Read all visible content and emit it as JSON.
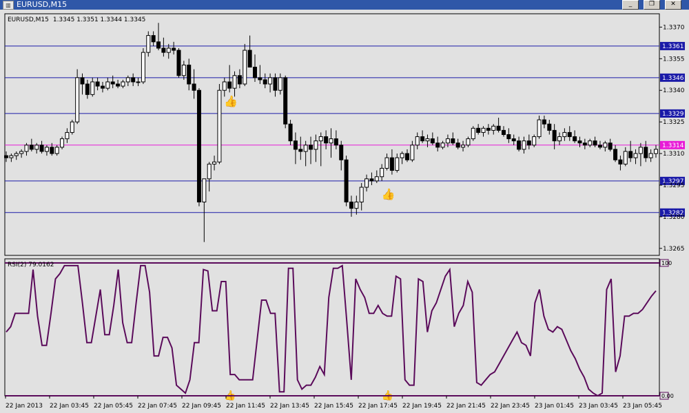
{
  "window": {
    "title": "EURUSD,M15",
    "minimize": "_",
    "restore": "❐",
    "close": "✕"
  },
  "colors": {
    "background": "#e1e1e1",
    "bull_candle": "#ffffff",
    "bear_candle": "#000000",
    "level_line": "#1a1aa8",
    "bid_line": "#e81ad7",
    "rsi_line": "#5a0a5a"
  },
  "chart_data": [
    {
      "type": "candlestick",
      "symbol_label": "EURUSD,M15",
      "ohlc_label": "1.3345 1.3351 1.3344 1.3345",
      "ylim": [
        1.3262,
        1.3376
      ],
      "y_ticks": [
        "1.3370",
        "1.3355",
        "1.3340",
        "1.3325",
        "1.3310",
        "1.3295",
        "1.3280",
        "1.3265"
      ],
      "horizontal_levels": [
        "1.3361",
        "1.3346",
        "1.3329",
        "1.3297",
        "1.3282"
      ],
      "bid_level": "1.3314",
      "x_ticks": [
        "22 Jan 2013",
        "22 Jan 03:45",
        "22 Jan 05:45",
        "22 Jan 07:45",
        "22 Jan 09:45",
        "22 Jan 11:45",
        "22 Jan 13:45",
        "22 Jan 15:45",
        "22 Jan 17:45",
        "22 Jan 19:45",
        "22 Jan 21:45",
        "22 Jan 23:45",
        "23 Jan 01:45",
        "23 Jan 03:45",
        "23 Jan 05:45"
      ],
      "signal_markers": [
        {
          "bar": 44,
          "kind": "buy"
        },
        {
          "bar": 75,
          "kind": "buy"
        }
      ],
      "candles": [
        [
          1.3309,
          1.3311,
          1.3306,
          1.3308
        ],
        [
          1.3308,
          1.331,
          1.3306,
          1.3309
        ],
        [
          1.3309,
          1.3311,
          1.3307,
          1.331
        ],
        [
          1.331,
          1.3312,
          1.3308,
          1.3311
        ],
        [
          1.3311,
          1.3315,
          1.3309,
          1.3314
        ],
        [
          1.3314,
          1.3317,
          1.3311,
          1.3312
        ],
        [
          1.3312,
          1.3315,
          1.331,
          1.3314
        ],
        [
          1.3314,
          1.3316,
          1.331,
          1.3311
        ],
        [
          1.3311,
          1.3314,
          1.3309,
          1.3313
        ],
        [
          1.3313,
          1.3315,
          1.3309,
          1.331
        ],
        [
          1.331,
          1.3314,
          1.3309,
          1.3313
        ],
        [
          1.3313,
          1.3318,
          1.3312,
          1.3317
        ],
        [
          1.3317,
          1.3322,
          1.3315,
          1.332
        ],
        [
          1.332,
          1.3326,
          1.3319,
          1.3325
        ],
        [
          1.3325,
          1.335,
          1.3324,
          1.3346
        ],
        [
          1.3346,
          1.3348,
          1.3338,
          1.3343
        ],
        [
          1.3343,
          1.3345,
          1.3336,
          1.3338
        ],
        [
          1.3338,
          1.3346,
          1.3337,
          1.3344
        ],
        [
          1.3344,
          1.3346,
          1.334,
          1.3342
        ],
        [
          1.3342,
          1.3344,
          1.3339,
          1.3341
        ],
        [
          1.3341,
          1.3346,
          1.334,
          1.3344
        ],
        [
          1.3344,
          1.3347,
          1.3341,
          1.3343
        ],
        [
          1.3343,
          1.3345,
          1.3341,
          1.3342
        ],
        [
          1.3342,
          1.3345,
          1.3341,
          1.3344
        ],
        [
          1.3344,
          1.3347,
          1.3342,
          1.3346
        ],
        [
          1.3346,
          1.3348,
          1.3342,
          1.3344
        ],
        [
          1.3344,
          1.3346,
          1.3342,
          1.3344
        ],
        [
          1.3344,
          1.336,
          1.3343,
          1.3358
        ],
        [
          1.3358,
          1.3368,
          1.3356,
          1.3366
        ],
        [
          1.3366,
          1.3368,
          1.3361,
          1.3363
        ],
        [
          1.3363,
          1.3372,
          1.3359,
          1.336
        ],
        [
          1.336,
          1.3365,
          1.3356,
          1.3358
        ],
        [
          1.3358,
          1.3362,
          1.3355,
          1.336
        ],
        [
          1.336,
          1.3363,
          1.3357,
          1.3359
        ],
        [
          1.3359,
          1.336,
          1.3346,
          1.3347
        ],
        [
          1.3347,
          1.3354,
          1.3345,
          1.3352
        ],
        [
          1.3352,
          1.3355,
          1.334,
          1.3343
        ],
        [
          1.3343,
          1.335,
          1.3336,
          1.334
        ],
        [
          1.334,
          1.3341,
          1.3285,
          1.3287
        ],
        [
          1.3287,
          1.3292,
          1.3268,
          1.3298
        ],
        [
          1.3298,
          1.3306,
          1.3292,
          1.3305
        ],
        [
          1.3305,
          1.3309,
          1.3302,
          1.3306
        ],
        [
          1.3306,
          1.3343,
          1.3305,
          1.334
        ],
        [
          1.334,
          1.3346,
          1.3337,
          1.3344
        ],
        [
          1.3344,
          1.3352,
          1.3339,
          1.3341
        ],
        [
          1.3341,
          1.3349,
          1.3337,
          1.3347
        ],
        [
          1.3347,
          1.335,
          1.3341,
          1.3343
        ],
        [
          1.3343,
          1.3362,
          1.3342,
          1.3359
        ],
        [
          1.3359,
          1.3366,
          1.3353,
          1.3351
        ],
        [
          1.3351,
          1.3357,
          1.3344,
          1.3346
        ],
        [
          1.3346,
          1.3352,
          1.3343,
          1.3345
        ],
        [
          1.3345,
          1.3348,
          1.3341,
          1.3343
        ],
        [
          1.3343,
          1.3348,
          1.3339,
          1.3346
        ],
        [
          1.3346,
          1.3348,
          1.3337,
          1.334
        ],
        [
          1.334,
          1.3348,
          1.3338,
          1.3346
        ],
        [
          1.3346,
          1.3347,
          1.3322,
          1.3324
        ],
        [
          1.3324,
          1.3326,
          1.3314,
          1.3316
        ],
        [
          1.3316,
          1.332,
          1.3305,
          1.3312
        ],
        [
          1.3312,
          1.3318,
          1.3307,
          1.3311
        ],
        [
          1.3311,
          1.3316,
          1.3304,
          1.3314
        ],
        [
          1.3314,
          1.3318,
          1.3305,
          1.3312
        ],
        [
          1.3312,
          1.3319,
          1.3306,
          1.3316
        ],
        [
          1.3316,
          1.332,
          1.3304,
          1.3318
        ],
        [
          1.3318,
          1.3321,
          1.3312,
          1.3315
        ],
        [
          1.3315,
          1.3322,
          1.3308,
          1.3317
        ],
        [
          1.3317,
          1.3321,
          1.3312,
          1.3314
        ],
        [
          1.3314,
          1.3316,
          1.3302,
          1.3307
        ],
        [
          1.3307,
          1.3309,
          1.3285,
          1.3287
        ],
        [
          1.3287,
          1.329,
          1.328,
          1.3284
        ],
        [
          1.3284,
          1.329,
          1.3281,
          1.3287
        ],
        [
          1.3287,
          1.3296,
          1.3283,
          1.3294
        ],
        [
          1.3294,
          1.33,
          1.3292,
          1.3298
        ],
        [
          1.3298,
          1.3301,
          1.3295,
          1.3297
        ],
        [
          1.3297,
          1.3302,
          1.3296,
          1.3299
        ],
        [
          1.3299,
          1.3305,
          1.3297,
          1.3303
        ],
        [
          1.3303,
          1.331,
          1.3302,
          1.3308
        ],
        [
          1.3308,
          1.3312,
          1.33,
          1.3302
        ],
        [
          1.3302,
          1.331,
          1.3301,
          1.3308
        ],
        [
          1.3308,
          1.3311,
          1.3305,
          1.331
        ],
        [
          1.331,
          1.3312,
          1.3306,
          1.3307
        ],
        [
          1.3307,
          1.3316,
          1.3306,
          1.3314
        ],
        [
          1.3314,
          1.332,
          1.3312,
          1.3318
        ],
        [
          1.3318,
          1.3321,
          1.3315,
          1.3316
        ],
        [
          1.3316,
          1.3319,
          1.3313,
          1.3317
        ],
        [
          1.3317,
          1.332,
          1.3314,
          1.3315
        ],
        [
          1.3315,
          1.3318,
          1.3311,
          1.3313
        ],
        [
          1.3313,
          1.3316,
          1.3312,
          1.3315
        ],
        [
          1.3315,
          1.3319,
          1.3313,
          1.3317
        ],
        [
          1.3317,
          1.332,
          1.3314,
          1.3315
        ],
        [
          1.3315,
          1.3317,
          1.3312,
          1.3313
        ],
        [
          1.3313,
          1.3316,
          1.3311,
          1.3314
        ],
        [
          1.3314,
          1.3318,
          1.3313,
          1.3317
        ],
        [
          1.3317,
          1.3323,
          1.3316,
          1.3322
        ],
        [
          1.3322,
          1.3324,
          1.3319,
          1.332
        ],
        [
          1.332,
          1.3323,
          1.3318,
          1.3322
        ],
        [
          1.3322,
          1.3324,
          1.3319,
          1.3321
        ],
        [
          1.3321,
          1.3324,
          1.3319,
          1.3323
        ],
        [
          1.3323,
          1.3327,
          1.332,
          1.3321
        ],
        [
          1.3321,
          1.3323,
          1.3318,
          1.3319
        ],
        [
          1.3319,
          1.3322,
          1.3315,
          1.3317
        ],
        [
          1.3317,
          1.3319,
          1.3314,
          1.3316
        ],
        [
          1.3316,
          1.3318,
          1.3311,
          1.3312
        ],
        [
          1.3312,
          1.3318,
          1.331,
          1.3316
        ],
        [
          1.3316,
          1.3319,
          1.3312,
          1.3314
        ],
        [
          1.3314,
          1.3319,
          1.3313,
          1.3318
        ],
        [
          1.3318,
          1.3328,
          1.3317,
          1.3326
        ],
        [
          1.3326,
          1.3328,
          1.3322,
          1.3324
        ],
        [
          1.3324,
          1.3326,
          1.3319,
          1.3321
        ],
        [
          1.3321,
          1.3324,
          1.3312,
          1.3316
        ],
        [
          1.3316,
          1.332,
          1.3314,
          1.3318
        ],
        [
          1.3318,
          1.3322,
          1.3316,
          1.332
        ],
        [
          1.332,
          1.3323,
          1.3316,
          1.3318
        ],
        [
          1.3318,
          1.3321,
          1.3315,
          1.3316
        ],
        [
          1.3316,
          1.3318,
          1.3313,
          1.3315
        ],
        [
          1.3315,
          1.3317,
          1.3312,
          1.3314
        ],
        [
          1.3314,
          1.3317,
          1.3313,
          1.3316
        ],
        [
          1.3316,
          1.3318,
          1.3313,
          1.3314
        ],
        [
          1.3314,
          1.3316,
          1.3312,
          1.3313
        ],
        [
          1.3313,
          1.3316,
          1.3311,
          1.3315
        ],
        [
          1.3315,
          1.3317,
          1.3311,
          1.3312
        ],
        [
          1.3312,
          1.3314,
          1.3306,
          1.3307
        ],
        [
          1.3307,
          1.3309,
          1.3302,
          1.3305
        ],
        [
          1.3305,
          1.3313,
          1.3304,
          1.3311
        ],
        [
          1.3311,
          1.3316,
          1.3306,
          1.3308
        ],
        [
          1.3308,
          1.3312,
          1.3305,
          1.331
        ],
        [
          1.331,
          1.3315,
          1.3304,
          1.3313
        ],
        [
          1.3313,
          1.3316,
          1.3306,
          1.3308
        ],
        [
          1.3308,
          1.3312,
          1.3306,
          1.331
        ],
        [
          1.331,
          1.3314,
          1.3308,
          1.3312
        ]
      ]
    },
    {
      "type": "line",
      "label": "RSI(2) 79.0162",
      "ylim": [
        0,
        100
      ],
      "y_ticks": [
        "100",
        "0.00"
      ],
      "values": [
        48,
        52,
        62,
        62,
        62,
        62,
        95,
        60,
        38,
        38,
        62,
        88,
        92,
        98,
        98,
        98,
        98,
        70,
        40,
        40,
        60,
        80,
        46,
        46,
        68,
        95,
        55,
        40,
        40,
        70,
        98,
        98,
        78,
        30,
        30,
        44,
        44,
        36,
        8,
        5,
        2,
        12,
        40,
        40,
        95,
        94,
        64,
        64,
        86,
        86,
        16,
        16,
        12,
        12,
        12,
        12,
        42,
        72,
        72,
        62,
        62,
        3,
        3,
        96,
        96,
        12,
        5,
        8,
        8,
        14,
        22,
        16,
        74,
        96,
        96,
        98,
        56,
        12,
        88,
        80,
        74,
        62,
        62,
        68,
        62,
        60,
        60,
        90,
        88,
        12,
        8,
        8,
        88,
        86,
        48,
        64,
        70,
        80,
        90,
        95,
        52,
        62,
        68,
        86,
        78,
        10,
        8,
        12,
        16,
        18,
        24,
        30,
        36,
        42,
        48,
        40,
        38,
        30,
        70,
        80,
        60,
        50,
        48,
        52,
        50,
        42,
        34,
        28,
        20,
        14,
        5,
        2,
        0,
        2,
        80,
        88,
        18,
        30,
        60,
        60,
        62,
        62,
        65,
        70,
        75,
        79
      ]
    }
  ]
}
